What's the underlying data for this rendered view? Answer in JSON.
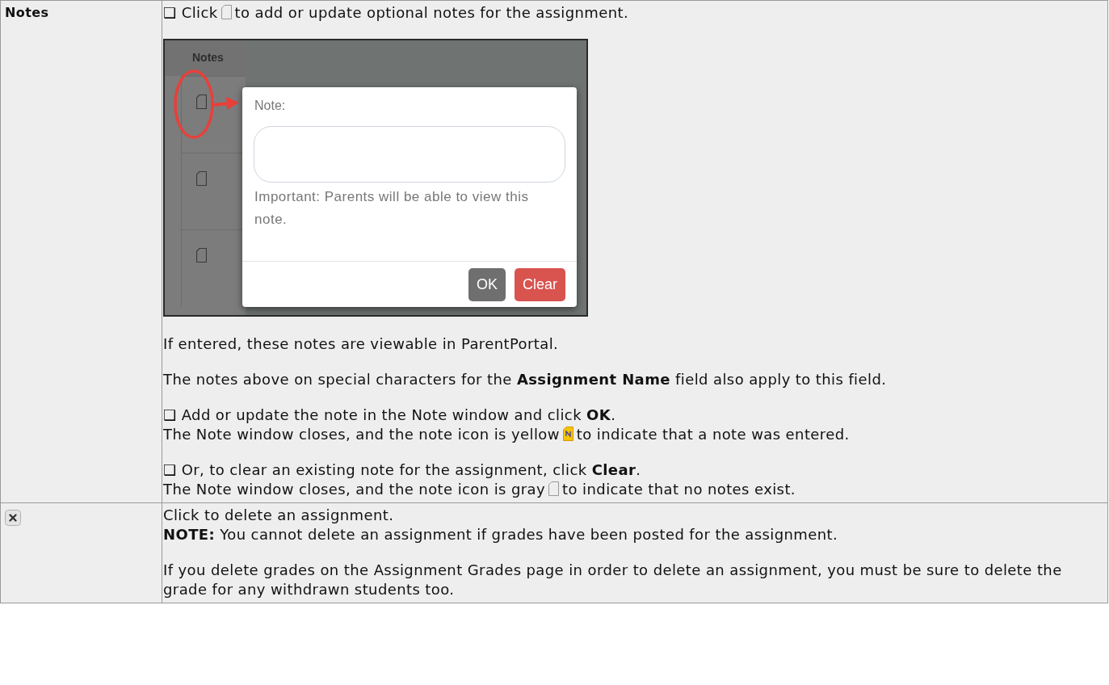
{
  "rows": [
    {
      "term": {
        "kind": "text",
        "text": "Notes"
      },
      "blocks": [
        {
          "kind": "step",
          "lines": [
            {
              "before": "❑ Click",
              "note_entered": false,
              "after": "to add or update optional notes for the assignment."
            }
          ]
        },
        {
          "kind": "screenshot",
          "column_header": "Notes",
          "note_label": "Note:",
          "hint": "Important: Parents will be able to view this note.",
          "buttons": [
            {
              "label": "OK",
              "kind": "default"
            },
            {
              "label": "Clear",
              "kind": "danger"
            }
          ]
        },
        {
          "kind": "para",
          "lines": [
            {
              "text": "If entered, these notes are viewable in ParentPortal."
            }
          ]
        },
        {
          "kind": "para",
          "lines": [
            {
              "text": "The notes above on special characters for the **Assignment Name** field also apply to this field."
            }
          ]
        },
        {
          "kind": "step",
          "lines": [
            {
              "text": "❑ Add or update the note in the Note window and click **OK**."
            },
            {
              "before": "The Note window closes, and the note icon is yellow",
              "note_entered": true,
              "after": "to indicate that a note was entered."
            }
          ]
        },
        {
          "kind": "step",
          "lines": [
            {
              "text": "❑ Or, to clear an existing note for the assignment, click **Clear**."
            },
            {
              "before": "The Note window closes, and the note icon is gray",
              "note_entered": false,
              "after": "to indicate that no notes exist."
            }
          ]
        }
      ]
    },
    {
      "term": {
        "kind": "delete-icon"
      },
      "blocks": [
        {
          "kind": "para",
          "lines": [
            {
              "text": "Click to delete an assignment."
            },
            {
              "text": "**NOTE:** You cannot delete an assignment if grades have been posted for the assignment."
            }
          ]
        },
        {
          "kind": "para",
          "lines": [
            {
              "text": "If you delete grades on the Assignment Grades page in order to delete an assignment, you must be sure to delete the grade for any withdrawn students too."
            }
          ]
        }
      ]
    }
  ]
}
